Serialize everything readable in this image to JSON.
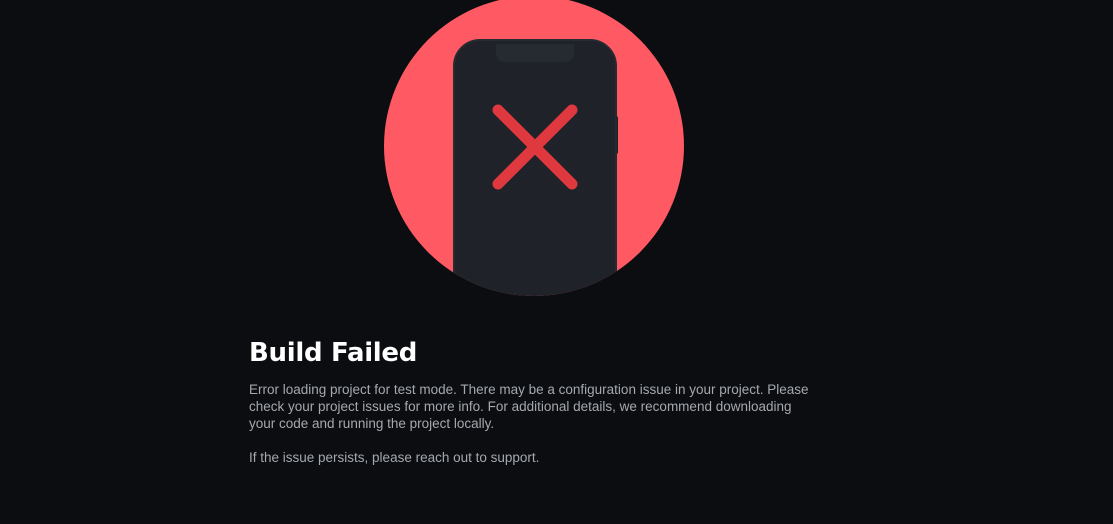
{
  "error": {
    "title": "Build Failed",
    "message": "Error loading project for test mode. There may be a configuration issue in your project. Please check your project issues for more info. For additional details, we recommend downloading your code and running the project locally.",
    "support_note": "If the issue persists, please reach out to support."
  },
  "illustration": {
    "icon": "phone-error-icon",
    "circle_color": "#ff5a64",
    "phone_color": "#1f2329",
    "cross_color": "#e0383f"
  },
  "colors": {
    "background": "#0b0d10",
    "title": "#ffffff",
    "text": "#a4a9b0"
  }
}
